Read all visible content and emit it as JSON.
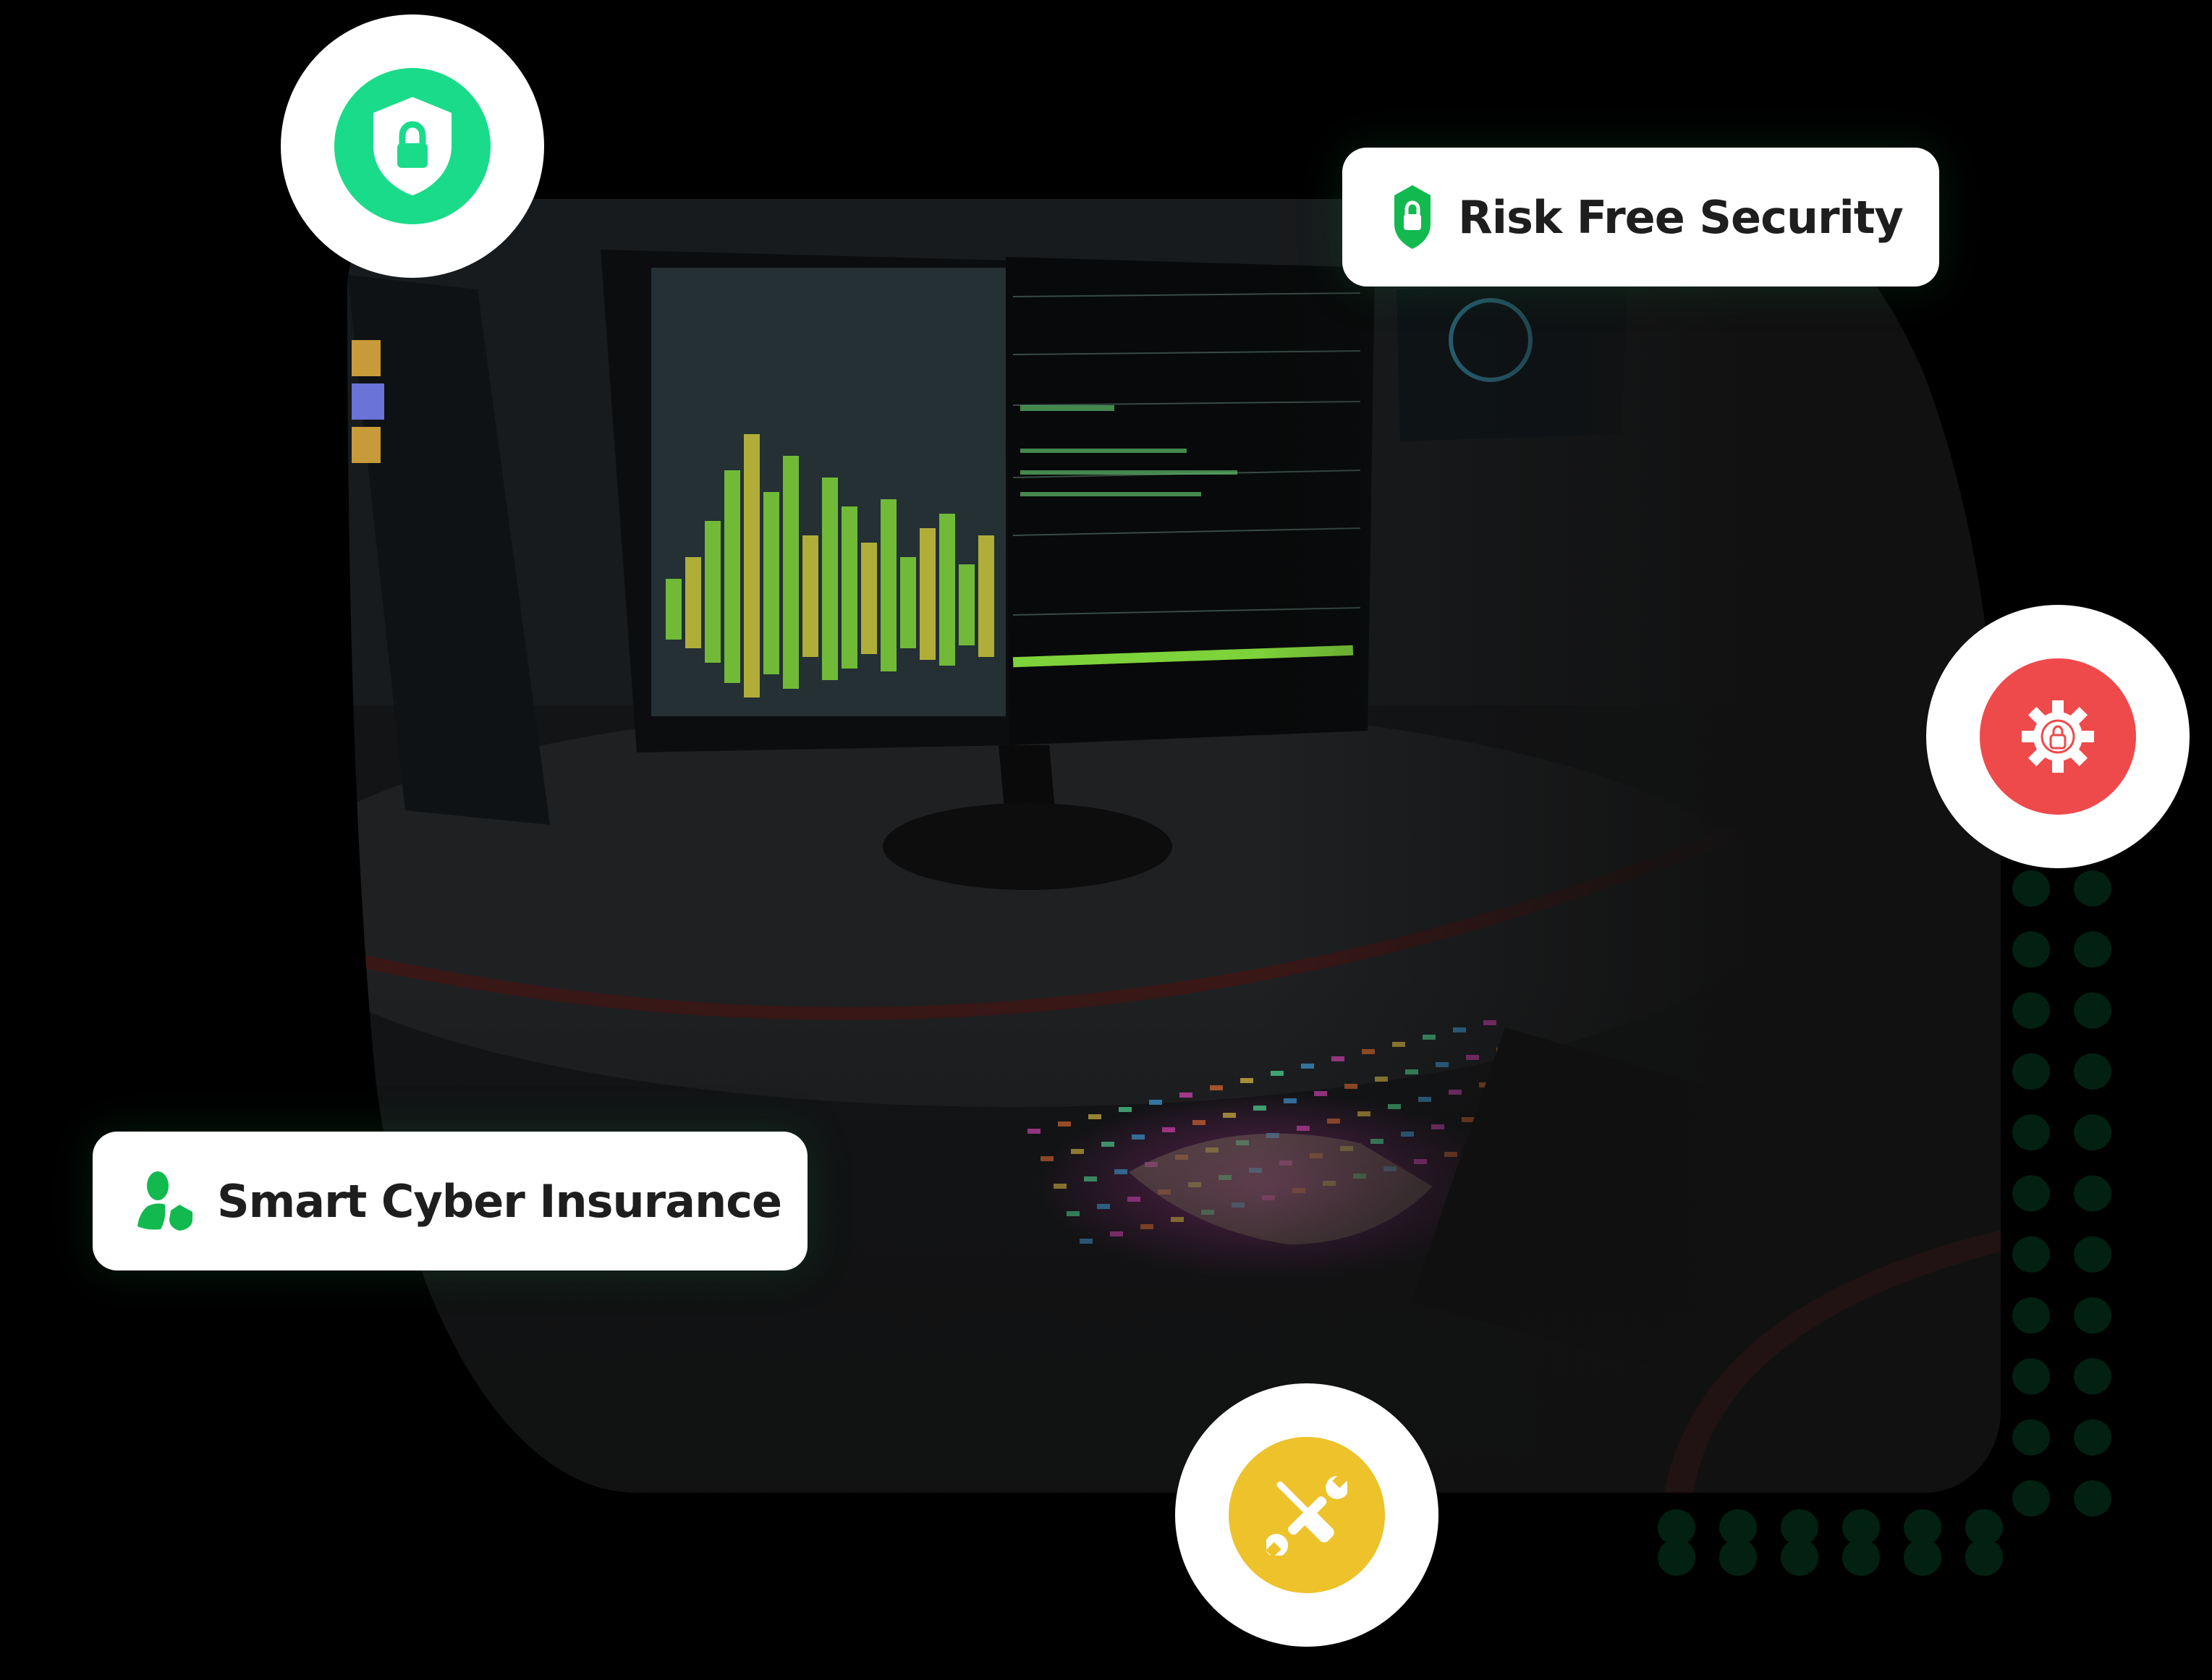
{
  "hero": {
    "photo_description": "Person typing on RGB backlit keyboard in front of monitors displaying terminal output and green bar graphs",
    "badges": [
      {
        "label": "Risk Free Security",
        "icon": "shield-lock-icon"
      },
      {
        "label": "Smart Cyber Insurance",
        "icon": "users-shield-icon"
      }
    ],
    "feature_icons": [
      {
        "name": "shield-lock-icon",
        "color": "#1ADB8A"
      },
      {
        "name": "gear-lock-icon",
        "color": "#EF4A4B"
      },
      {
        "name": "tools-icon",
        "color": "#EDC22B"
      }
    ]
  },
  "colors": {
    "background": "#000000",
    "badge_green": "#12B94F",
    "dot_grid": "#022112"
  }
}
